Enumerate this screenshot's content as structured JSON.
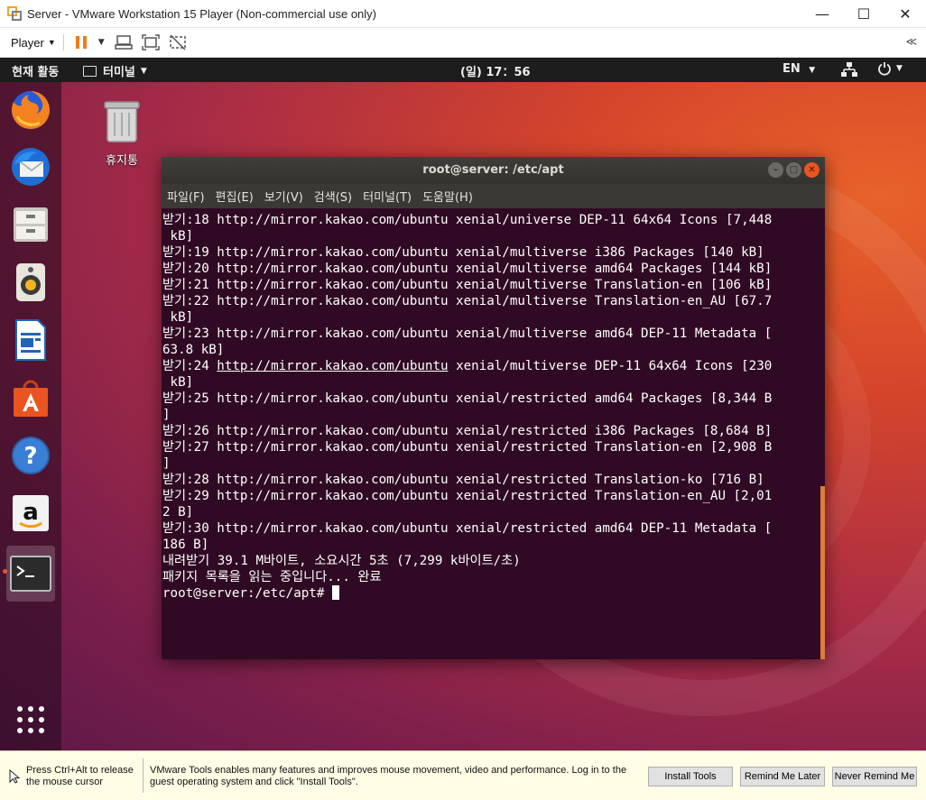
{
  "vm_window": {
    "title": "Server - VMware Workstation 15 Player (Non-commercial use only)",
    "minimize_glyph": "—",
    "maximize_glyph": "☐",
    "close_glyph": "✕"
  },
  "vm_toolbar": {
    "player_label": "Player",
    "icons": [
      "pause-icon",
      "send-ctrl-alt-del-icon",
      "fullscreen-icon",
      "unity-icon"
    ],
    "collapse_glyph": "≪"
  },
  "gnome_topbar": {
    "activities": "현재 활동",
    "app_menu": "터미널",
    "clock": "(일) 17：56",
    "language": "EN"
  },
  "dock": {
    "items": [
      "firefox-icon",
      "thunderbird-icon",
      "files-icon",
      "rhythmbox-icon",
      "libreoffice-writer-icon",
      "software-center-icon",
      "help-icon",
      "amazon-icon",
      "terminal-icon"
    ],
    "active": "terminal-icon"
  },
  "desktop": {
    "trash_label": "휴지통"
  },
  "terminal": {
    "title": "root@server: /etc/apt",
    "menu": [
      "파일(F)",
      "편집(E)",
      "보기(V)",
      "검색(S)",
      "터미널(T)",
      "도움말(H)"
    ],
    "lines": [
      "받기:18 http://mirror.kakao.com/ubuntu xenial/universe DEP-11 64x64 Icons [7,448",
      " kB]",
      "받기:19 http://mirror.kakao.com/ubuntu xenial/multiverse i386 Packages [140 kB]",
      "받기:20 http://mirror.kakao.com/ubuntu xenial/multiverse amd64 Packages [144 kB]",
      "받기:21 http://mirror.kakao.com/ubuntu xenial/multiverse Translation-en [106 kB]",
      "받기:22 http://mirror.kakao.com/ubuntu xenial/multiverse Translation-en_AU [67.7",
      " kB]",
      "받기:23 http://mirror.kakao.com/ubuntu xenial/multiverse amd64 DEP-11 Metadata [",
      "63.8 kB]"
    ],
    "underlined_line": {
      "prefix": "받기:24 ",
      "url": "http://mirror.kakao.com/ubuntu",
      "suffix": " xenial/multiverse DEP-11 64x64 Icons [230"
    },
    "lines_after": [
      " kB]",
      "받기:25 http://mirror.kakao.com/ubuntu xenial/restricted amd64 Packages [8,344 B",
      "]",
      "받기:26 http://mirror.kakao.com/ubuntu xenial/restricted i386 Packages [8,684 B]",
      "받기:27 http://mirror.kakao.com/ubuntu xenial/restricted Translation-en [2,908 B",
      "]",
      "받기:28 http://mirror.kakao.com/ubuntu xenial/restricted Translation-ko [716 B]",
      "받기:29 http://mirror.kakao.com/ubuntu xenial/restricted Translation-en_AU [2,01",
      "2 B]",
      "받기:30 http://mirror.kakao.com/ubuntu xenial/restricted amd64 DEP-11 Metadata [",
      "186 B]",
      "내려받기 39.1 M바이트, 소요시간 5초 (7,299 k바이트/초)",
      "패키지 목록을 읽는 중입니다... 완료"
    ],
    "prompt": "root@server:/etc/apt# "
  },
  "vm_statusbar": {
    "mouse_hint_line1": "Press Ctrl+Alt to release",
    "mouse_hint_line2": "the mouse cursor",
    "tools_message_line1": "VMware Tools enables many features and improves mouse movement, video and performance. Log in to the",
    "tools_message_line2": "guest operating system and click \"Install Tools\".",
    "install_tools": "Install Tools",
    "remind_later": "Remind Me Later",
    "never_remind": "Never Remind Me"
  }
}
